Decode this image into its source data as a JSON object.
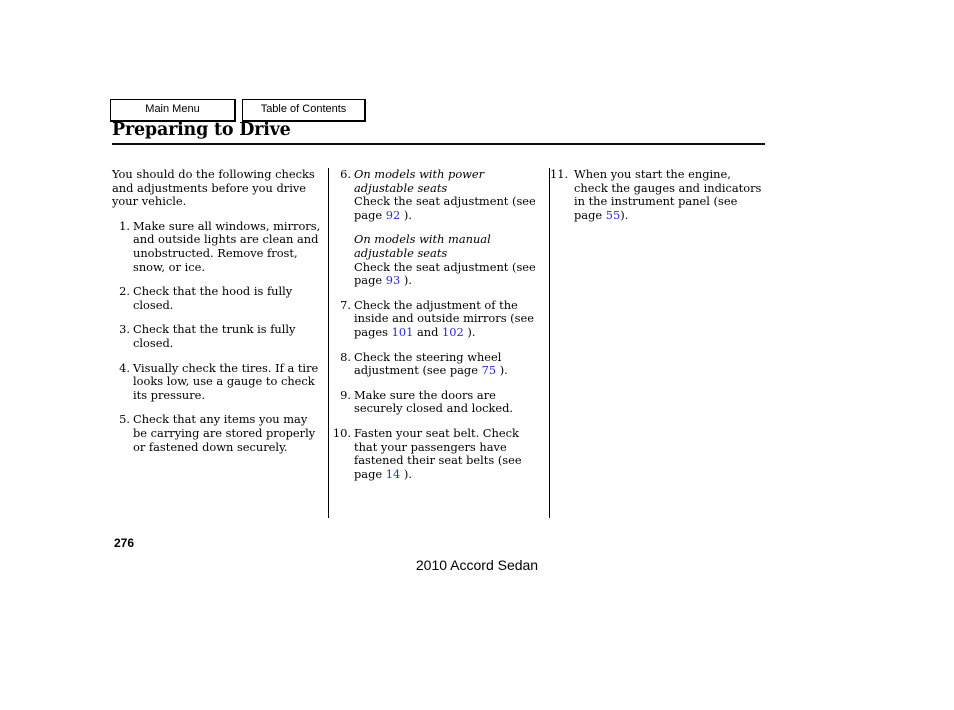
{
  "nav": {
    "main_menu": "Main Menu",
    "table_of_contents": "Table of Contents"
  },
  "header": {
    "title": "Preparing to Drive"
  },
  "columns": {
    "col1": {
      "intro": "You should do the following checks and adjustments before you drive your vehicle.",
      "items": [
        {
          "num": "1.",
          "text": "Make sure all windows, mirrors, and outside lights are clean and unobstructed. Remove frost, snow, or ice."
        },
        {
          "num": "2.",
          "text": "Check that the hood is fully closed."
        },
        {
          "num": "3.",
          "text": "Check that the trunk is fully closed."
        },
        {
          "num": "4.",
          "text": "Visually check the tires. If a tire looks low, use a gauge to check its pressure."
        },
        {
          "num": "5.",
          "text": "Check that any items you may be carrying are stored properly or fastened down securely."
        }
      ]
    },
    "col2": {
      "item6": {
        "num": "6.",
        "heading_a": "On models with power adjustable seats",
        "body_a_pre": "Check the seat adjustment (see page",
        "link_a": "92",
        "body_a_post": ").",
        "heading_b": "On models with manual adjustable seats",
        "body_b_pre": "Check the seat adjustment (see page",
        "link_b": "93",
        "body_b_post": ")."
      },
      "item7": {
        "num": "7.",
        "pre": "Check the adjustment of the inside and outside mirrors (see pages",
        "link_a": "101",
        "mid": "and",
        "link_b": "102",
        "post": ")."
      },
      "item8": {
        "num": "8.",
        "pre": "Check the steering wheel adjustment (see page",
        "link": "75",
        "post": ")."
      },
      "item9": {
        "num": "9.",
        "text": "Make sure the doors are securely closed and locked."
      },
      "item10": {
        "num": "10.",
        "pre": "Fasten your seat belt. Check that your passengers have fastened their seat belts (see page",
        "link": "14",
        "post": ")."
      }
    },
    "col3": {
      "item11": {
        "num": "11.",
        "pre": "When you start the engine, check the gauges and indicators in the instrument panel (see page",
        "link": "55",
        "post": ")."
      }
    }
  },
  "footer": {
    "page_number": "276",
    "document": "2010 Accord Sedan"
  },
  "colors": {
    "link": "#2a2ae0",
    "text": "#000000",
    "background": "#ffffff"
  }
}
